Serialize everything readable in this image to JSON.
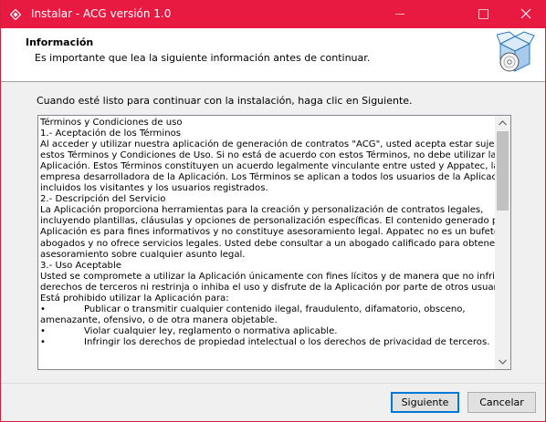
{
  "window": {
    "title": "Instalar - ACG versión 1.0",
    "accent": "#e81a42",
    "icons": {
      "app": "app-logo-icon",
      "minimize": "minimize-icon",
      "maximize": "maximize-icon",
      "close": "close-icon"
    }
  },
  "header": {
    "title": "Información",
    "subtitle": "Es importante que lea la siguiente información antes de continuar.",
    "image": "setup-box-disc-icon"
  },
  "prompt": "Cuando esté listo para continuar con la instalación, haga clic en Siguiente.",
  "memo": {
    "lines": [
      "Términos y Condiciones de uso",
      "1.- Aceptación de los Términos",
      "Al acceder y utilizar nuestra aplicación de generación de contratos \"ACG\", usted acepta estar sujeto a",
      "estos Términos y Condiciones de Uso. Si no está de acuerdo con estos Términos, no debe utilizar la",
      "Aplicación. Estos Términos constituyen un acuerdo legalmente vinculante entre usted y Appatec, la",
      "empresa desarrolladora de la Aplicación. Los Términos se aplican a todos los usuarios de la Aplicación,",
      "incluidos los visitantes y los usuarios registrados.",
      "2.- Descripción del Servicio",
      "La Aplicación proporciona herramientas para la creación y personalización de contratos legales,",
      "incluyendo plantillas, cláusulas y opciones de personalización específicas. El contenido generado por la",
      "Aplicación es para fines informativos y no constituye asesoramiento legal. Appatec no es un bufete de",
      "abogados y no ofrece servicios legales. Usted debe consultar a un abogado calificado para obtener",
      "asesoramiento sobre cualquier asunto legal.",
      "3.- Uso Aceptable",
      "Usted se compromete a utilizar la Aplicación únicamente con fines lícitos y de manera que no infrinja los",
      "derechos de terceros ni restrinja o inhiba el uso y disfrute de la Aplicación por parte de otros usuarios.",
      "Está prohibido utilizar la Aplicación para:"
    ],
    "bullet_lines": [
      {
        "bullet": "•",
        "text": "Publicar o transmitir cualquier contenido ilegal, fraudulento, difamatorio, obsceno,"
      },
      {
        "bullet": "",
        "text": "amenazante, ofensivo, o de otra manera objetable."
      },
      {
        "bullet": "•",
        "text": "Violar cualquier ley, reglamento o normativa aplicable."
      },
      {
        "bullet": "•",
        "text": "Infringir los derechos de propiedad intelectual o los derechos de privacidad de terceros."
      }
    ],
    "scroll_position": 0.0
  },
  "buttons": {
    "next": "Siguiente",
    "cancel": "Cancelar"
  }
}
